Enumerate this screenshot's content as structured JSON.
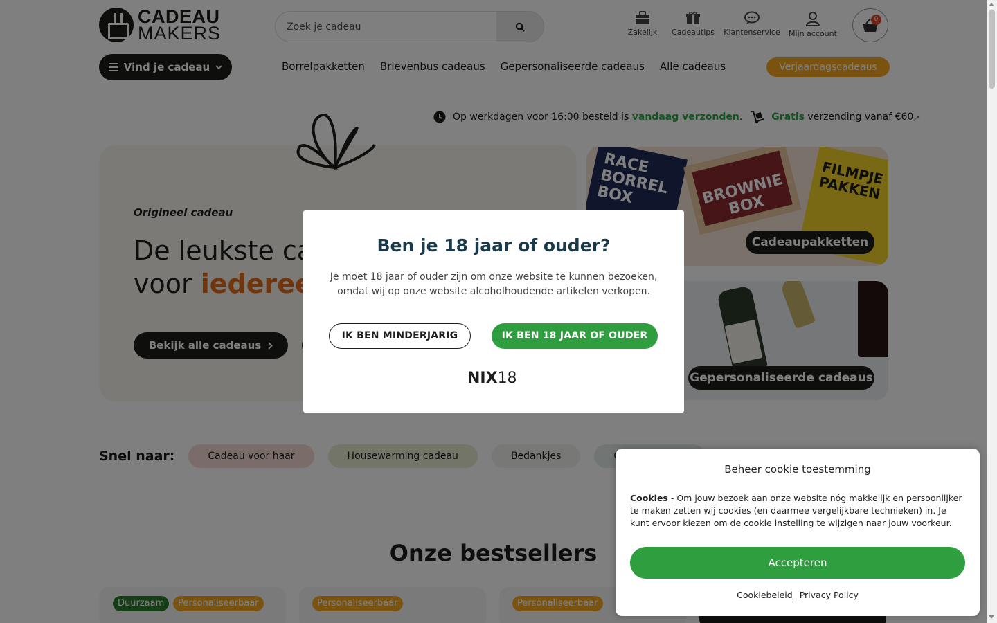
{
  "header": {
    "logo_top": "CADEAU",
    "logo_bottom": "MAKERS",
    "search_placeholder": "Zoek je cadeau",
    "icons": [
      {
        "label": "Zakelijk",
        "icon": "briefcase-icon"
      },
      {
        "label": "Cadeautips",
        "icon": "gift-icon"
      },
      {
        "label": "Klantenservice",
        "icon": "chat-icon"
      },
      {
        "label": "Mijn account",
        "icon": "user-icon"
      }
    ],
    "cart_count": "0",
    "vind_label": "Vind je cadeau",
    "nav": [
      "Borrelpakketten",
      "Brievenbus cadeaus",
      "Gepersonaliseerde cadeaus",
      "Alle cadeaus "
    ],
    "birthday_label": "Verjaardagscadeaus"
  },
  "usps": {
    "shipping_pre": "Op werkdagen voor 16:00 besteld is ",
    "shipping_hl": "vandaag verzonden",
    "shipping_post": ".",
    "free_hl": "Gratis",
    "free_post": " verzending vanaf €60,-"
  },
  "hero": {
    "kicker": "Origineel cadeau",
    "title_line1": "De leukste cad",
    "title_line2_pre": "voor ",
    "title_line2_accent": "iedereen",
    "cta": "Bekijk alle cadeaus"
  },
  "tiles": [
    {
      "label": "Cadeaupakketten",
      "boxes": [
        "RACE BORREL BOX",
        "BROWNIE BOX",
        "FILMPJE PAKKEN"
      ]
    },
    {
      "label": "Gepersonaliseerde cadeaus"
    }
  ],
  "snel": {
    "label": "Snel naar:",
    "chips": [
      {
        "label": "Cadeau voor haar",
        "bg": "#f4d9d2"
      },
      {
        "label": "Housewarming cadeau",
        "bg": "#e6ead3"
      },
      {
        "label": "Bedankjes",
        "bg": "#f1f1ef"
      },
      {
        "label": "Cadeau",
        "bg": "#e3ecea"
      }
    ]
  },
  "bestsellers_title": "Onze bestsellers",
  "badges": [
    {
      "label": "Duurzaam",
      "color": "#2d7d2d"
    },
    {
      "label": "Personaliseerbaar",
      "color": "#f6a623"
    },
    {
      "label": "Personaliseerbaar",
      "color": "#f6a623"
    },
    {
      "label": "Personaliseerbaar",
      "color": "#f6a623"
    }
  ],
  "age_modal": {
    "title": "Ben je 18 jaar of ouder?",
    "text": "Je moet 18 jaar of ouder zijn om onze website te kunnen bezoeken, omdat wij op onze website alcoholhoudende artikelen verkopen.",
    "btn_minor": "IK BEN MINDERJARIG",
    "btn_adult": "IK BEN 18 JAAR OF OUDER",
    "logo_bold": "NIX",
    "logo_thin": "18"
  },
  "cookie": {
    "title": "Beheer cookie toestemming",
    "text_bold": "Cookies",
    "text_body": " - Om jouw bezoek aan onze website nóg makkelijk en persoonlijker te maken zetten wij cookies (en daarmee vergelijkbare technieken) in. Je kunt ervoor kiezen om de ",
    "text_link": "cookie instelling te wijzigen",
    "text_end": " naar jouw voorkeur.",
    "accept": "Accepteren",
    "link1": "Cookiebeleid",
    "link2": "Privacy Policy"
  }
}
